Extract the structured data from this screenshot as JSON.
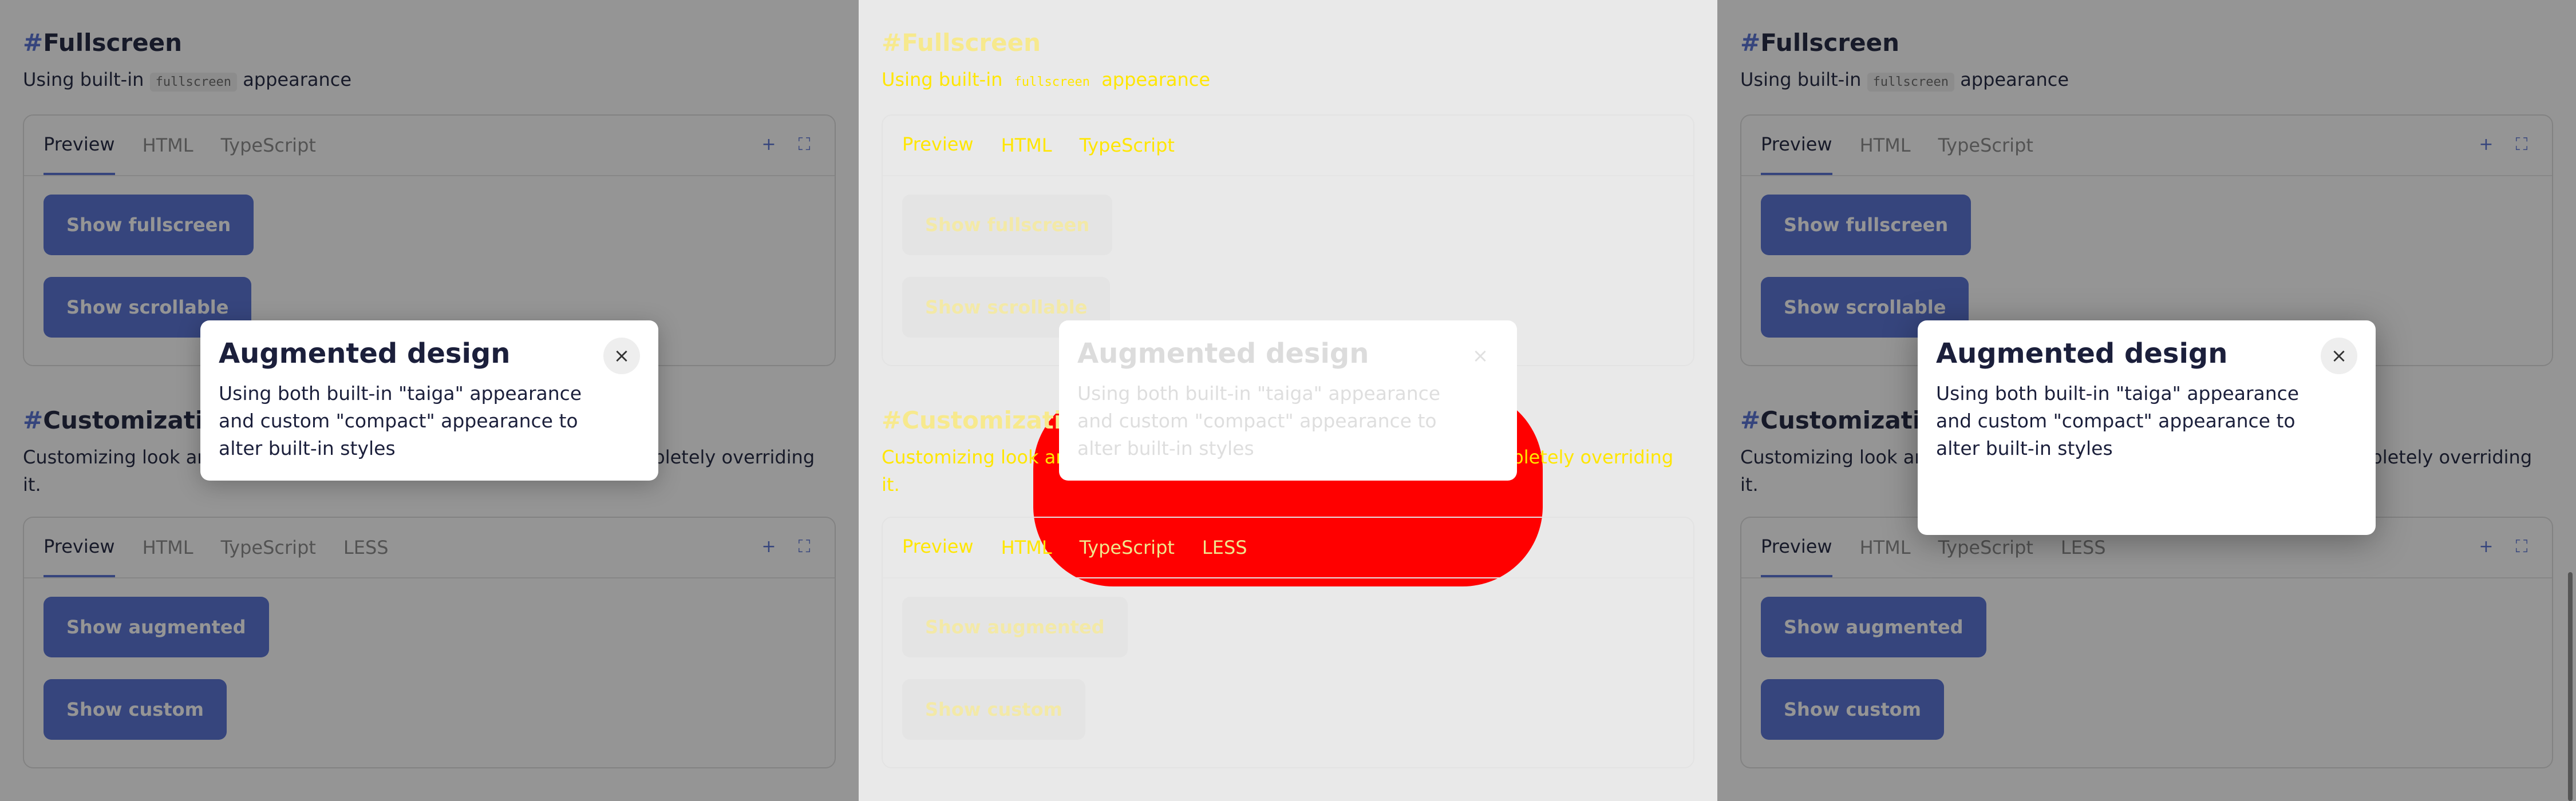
{
  "sections": {
    "fullscreen": {
      "hash": "#",
      "title": "Fullscreen",
      "desc_before": "Using built-in",
      "desc_code": "fullscreen",
      "desc_after": "appearance",
      "tabs": [
        "Preview",
        "HTML",
        "TypeScript"
      ],
      "buttons": [
        "Show fullscreen",
        "Show scrollable"
      ]
    },
    "customization": {
      "hash": "#",
      "title": "Customization",
      "desc": "Customizing look and feel of dialogs with built-in appearance or completely overriding it.",
      "tabs": [
        "Preview",
        "HTML",
        "TypeScript",
        "LESS"
      ],
      "buttons": [
        "Show augmented",
        "Show custom"
      ]
    }
  },
  "modal": {
    "title": "Augmented design",
    "text": "Using both built-in \"taiga\" appearance and custom \"compact\" appearance to alter built-in styles",
    "close": "×"
  },
  "icons": {
    "expand_icon": "+",
    "fullscreen_icon": "⛶"
  },
  "colors": {
    "accent": "#526ed3",
    "text": "#1b1f3b",
    "diff_red": "#ff0000",
    "diff_yellow": "#ffe600"
  }
}
